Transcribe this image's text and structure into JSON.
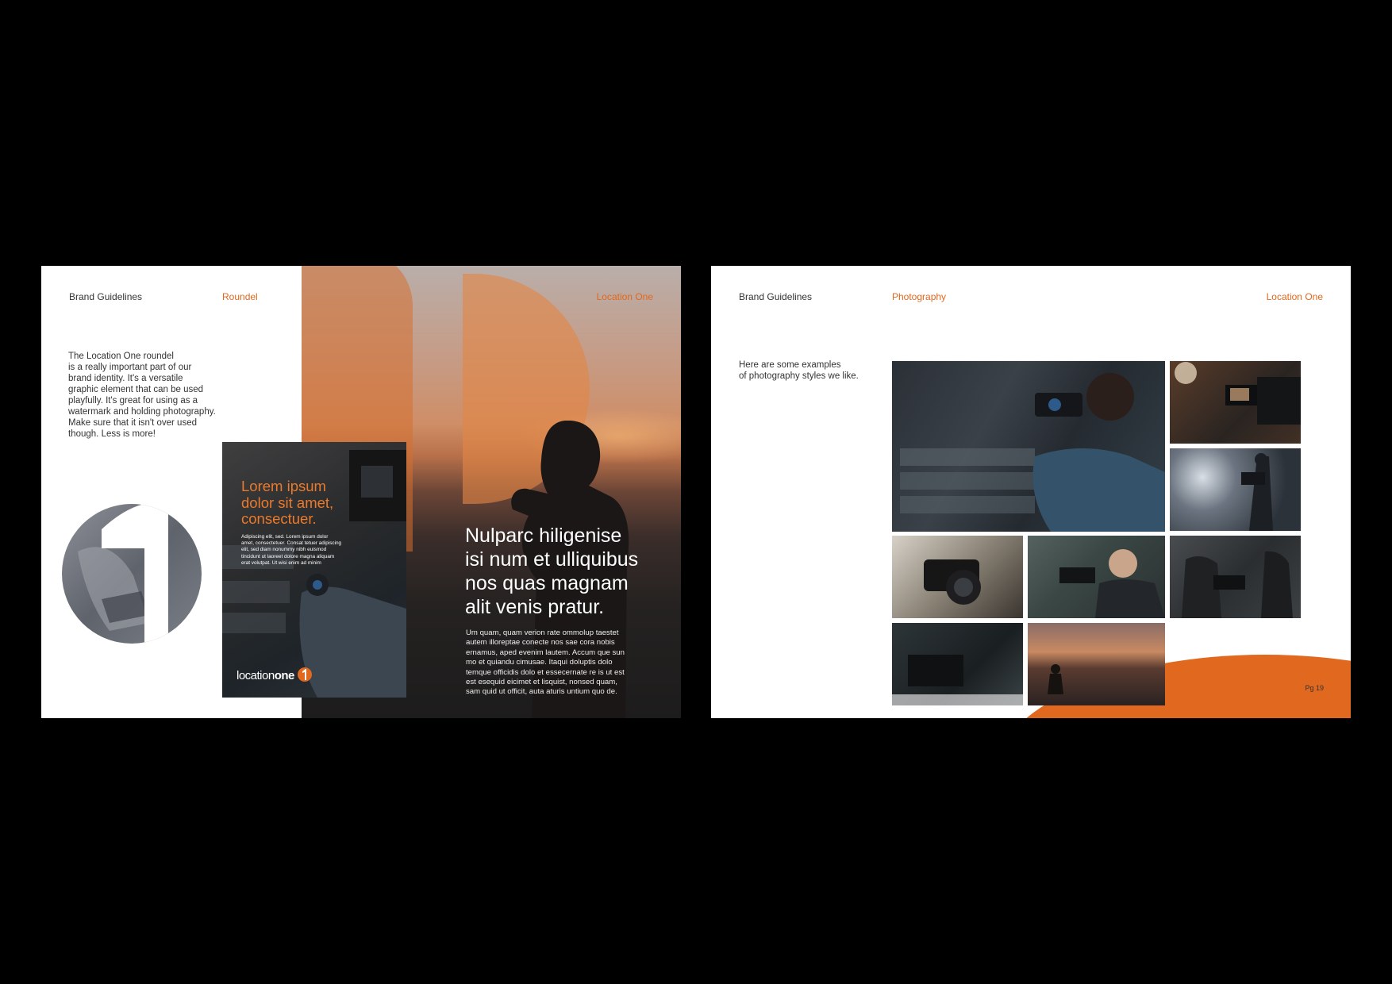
{
  "left_page": {
    "header_left": "Brand Guidelines",
    "header_section": "Roundel",
    "header_right": "Location One",
    "intro_lines": [
      "The Location One roundel",
      "is a really important part of our",
      "brand identity. It's a versatile",
      "graphic element that can be used",
      "playfully. It's great for using as a",
      "watermark and holding photography.",
      "Make sure that it isn't over used",
      "though. Less is more!"
    ],
    "poster": {
      "headline_lines": [
        "Lorem ipsum",
        "dolor sit amet,",
        "consectuer."
      ],
      "body_lines": [
        "Adipiscing elit, sed. Lorem ipsum dolor",
        "amet, consectetuer. Consat tetuer adipiscing",
        "elit, sed diam nonummy nibh euismod",
        "tincidunt ut laoreet dolore magna aliquam",
        "erat volutpat. Ut wisi enim ad minim"
      ],
      "logo_light": "location",
      "logo_bold": "one"
    },
    "hero": {
      "headline_lines": [
        "Nulparc hiligenise",
        "isi num et ulliquibus",
        "nos quas magnam",
        "alit venis pratur."
      ],
      "body_lines": [
        "Um quam, quam verion rate ommolup taestet",
        "autem illoreptae conecte nos sae cora nobis",
        "ernamus, aped evenim lautem. Accum que sun",
        "mo et quiandu cimusae. Itaqui doluptis dolo",
        "temque officidis dolo et essecernate re is ut est",
        "est esequid eicimet et lisquist, nonsed quam,",
        "sam quid ut officit, auta aturis untium quo de."
      ]
    }
  },
  "right_page": {
    "header_left": "Brand Guidelines",
    "header_section": "Photography",
    "header_right": "Location One",
    "intro_lines": [
      "Here are some examples",
      "of photography styles we like."
    ],
    "page_number": "Pg 19"
  },
  "colors": {
    "accent": "#e0681f",
    "background": "#000000",
    "page": "#ffffff",
    "text": "#333333"
  }
}
